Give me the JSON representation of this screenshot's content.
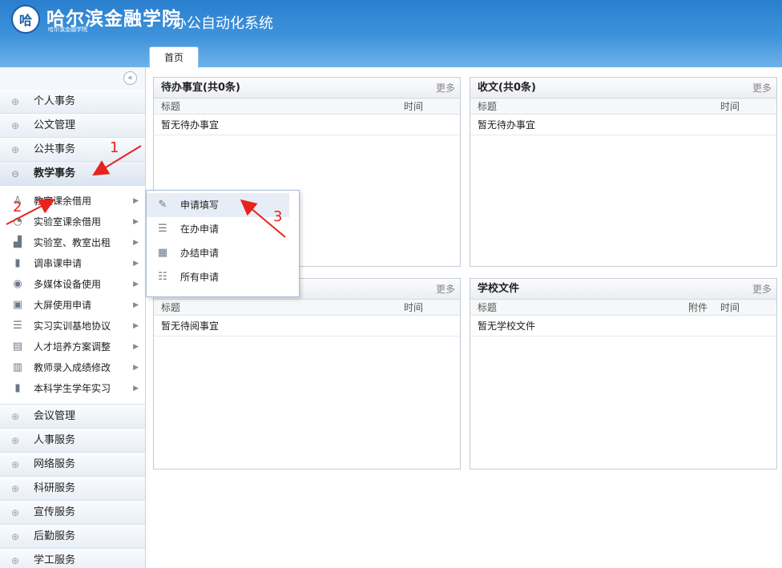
{
  "header": {
    "logo_text": "哈",
    "school_name": "哈尔滨金融学院",
    "school_subtitle": "哈尔滨金融学院",
    "system_name": "办公自动化系统",
    "home_tab": "首页"
  },
  "sidebar": {
    "collapse_glyph": "«",
    "groups_top": [
      "个人事务",
      "公文管理",
      "公共事务"
    ],
    "open_group": "教学事务",
    "sub_items": [
      {
        "label": "教室课余借用",
        "icon": "person-icon"
      },
      {
        "label": "实验室课余借用",
        "icon": "pie-chart-icon"
      },
      {
        "label": "实验室、教室出租",
        "icon": "bar-chart-icon"
      },
      {
        "label": "调串课申请",
        "icon": "person-walk-icon"
      },
      {
        "label": "多媒体设备使用",
        "icon": "media-icon"
      },
      {
        "label": "大屏使用申请",
        "icon": "screen-icon"
      },
      {
        "label": "实习实训基地协议",
        "icon": "list-icon"
      },
      {
        "label": "人才培养方案调整",
        "icon": "edit-doc-icon"
      },
      {
        "label": "教师录入成绩修改",
        "icon": "doc-check-icon"
      },
      {
        "label": "本科学生学年实习",
        "icon": "person-walk-icon"
      }
    ],
    "groups_bottom": [
      "会议管理",
      "人事服务",
      "网络服务",
      "科研服务",
      "宣传服务",
      "后勤服务",
      "学工服务"
    ]
  },
  "flyout": {
    "items": [
      {
        "label": "申请填写",
        "icon": "edit-icon"
      },
      {
        "label": "在办申请",
        "icon": "list-icon"
      },
      {
        "label": "办结申请",
        "icon": "calendar-icon"
      },
      {
        "label": "所有申请",
        "icon": "checklist-icon"
      }
    ]
  },
  "panels": {
    "todo": {
      "title": "待办事宜(共0条)",
      "more": "更多",
      "col_title": "标题",
      "col_time": "时间",
      "empty": "暂无待办事宜"
    },
    "inbox": {
      "title": "收文(共0条)",
      "more": "更多",
      "col_title": "标题",
      "col_time": "时间",
      "empty": "暂无待办事宜"
    },
    "toread": {
      "title": "",
      "more": "更多",
      "col_title": "标题",
      "col_time": "时间",
      "empty": "暂无待阅事宜"
    },
    "school_files": {
      "title": "学校文件",
      "more": "更多",
      "col_title": "标题",
      "col_attach": "附件",
      "col_time": "时间",
      "empty": "暂无学校文件"
    }
  },
  "annotations": {
    "one": "1",
    "two": "2",
    "three": "3",
    "color": "#e8231e"
  },
  "colors": {
    "header_blue": "#2a7fce",
    "accent_red": "#e8231e"
  }
}
